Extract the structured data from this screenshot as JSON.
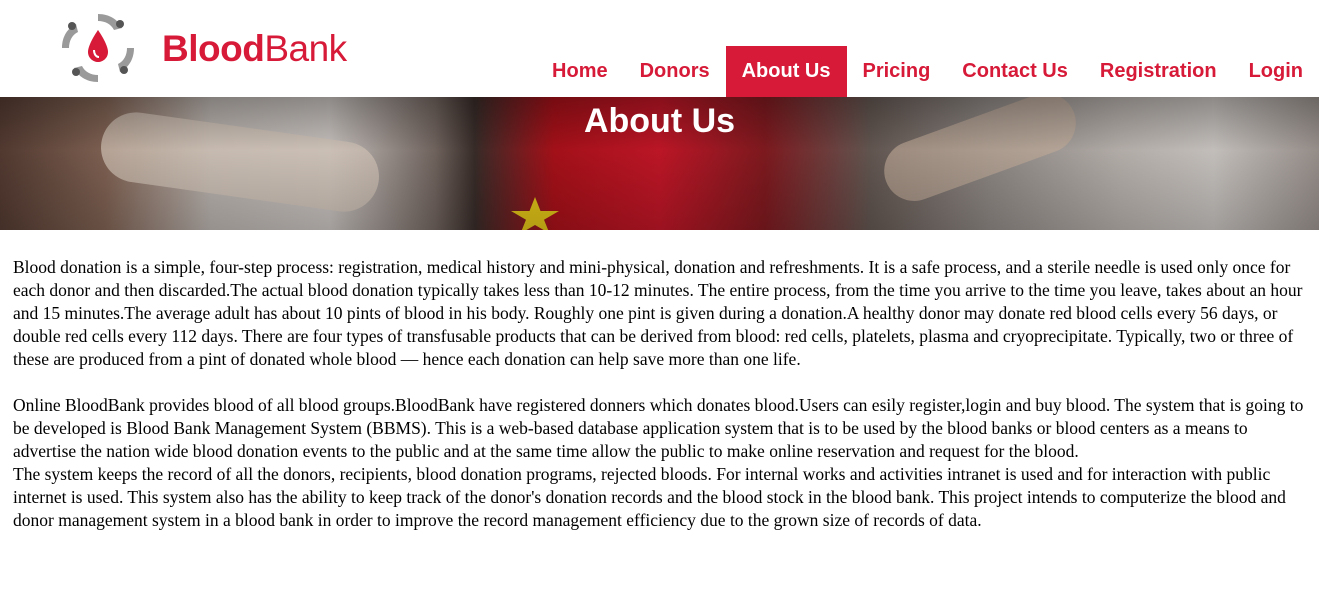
{
  "brand": {
    "part1": "Blood",
    "part2": "Bank",
    "color": "#d61a38"
  },
  "nav": {
    "items": [
      {
        "label": "Home"
      },
      {
        "label": "Donors"
      },
      {
        "label": "About Us",
        "active": true
      },
      {
        "label": "Pricing"
      },
      {
        "label": "Contact Us"
      },
      {
        "label": "Registration"
      },
      {
        "label": "Login"
      }
    ]
  },
  "banner": {
    "title": "About Us"
  },
  "content": {
    "p1": "Blood donation is a simple, four-step process: registration, medical history and mini-physical, donation and refreshments. It is a safe process, and a sterile needle is used only once for each donor and then discarded.The actual blood donation typically takes less than 10-12 minutes. The entire process, from the time you arrive to the time you leave, takes about an hour and 15 minutes.The average adult has about 10 pints of blood in his body. Roughly one pint is given during a donation.A healthy donor may donate red blood cells every 56 days, or double red cells every 112 days. There are four types of transfusable products that can be derived from blood: red cells, platelets, plasma and cryoprecipitate. Typically, two or three of these are produced from a pint of donated whole blood — hence each donation can help save more than one life.",
    "p2": "Online BloodBank provides blood of all blood groups.BloodBank have registered donners which donates blood.Users can esily register,login and buy blood. The system that is going to be developed is Blood Bank Management System (BBMS). This is a web-based database application system that is to be used by the blood banks or blood centers as a means to advertise the nation wide blood donation events to the public and at the same time allow the public to make online reservation and request for the blood.",
    "p3": "The system keeps the record of all the donors, recipients, blood donation programs, rejected bloods. For internal works and activities intranet is used and for interaction with public internet is used. This system also has the ability to keep track of the donor's donation records and the blood stock in the blood bank. This project intends to computerize the blood and donor management system in a blood bank in order to improve the record management efficiency due to the grown size of records of data."
  }
}
